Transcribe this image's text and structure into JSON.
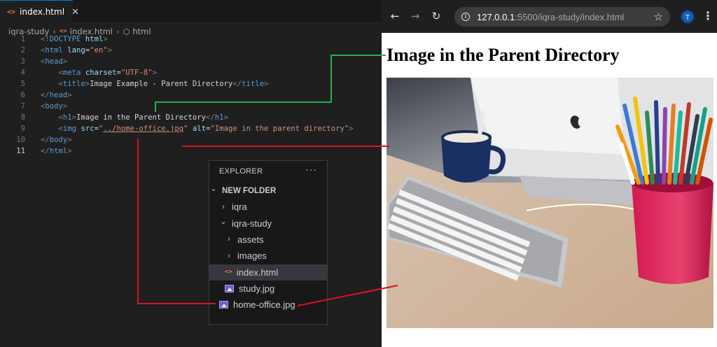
{
  "editor": {
    "tab": {
      "filename": "index.html",
      "close": "✕"
    },
    "breadcrumb": {
      "folder": "iqra-study",
      "file": "index.html",
      "symbol": "html"
    },
    "lines": [
      {
        "n": "1",
        "parts": [
          [
            "tg",
            "<!"
          ],
          [
            "tn",
            "DOCTYPE"
          ],
          [
            "pl",
            " "
          ],
          [
            "an",
            "html"
          ],
          [
            "tg",
            ">"
          ]
        ]
      },
      {
        "n": "2",
        "parts": [
          [
            "tg",
            "<"
          ],
          [
            "tn",
            "html"
          ],
          [
            "pl",
            " "
          ],
          [
            "an",
            "lang"
          ],
          [
            "pl",
            "="
          ],
          [
            "av",
            "\"en\""
          ],
          [
            "tg",
            ">"
          ]
        ]
      },
      {
        "n": "3",
        "parts": [
          [
            "tg",
            "<"
          ],
          [
            "tn",
            "head"
          ],
          [
            "tg",
            ">"
          ]
        ]
      },
      {
        "n": "4",
        "parts": [
          [
            "pl",
            "    "
          ],
          [
            "tg",
            "<"
          ],
          [
            "tn",
            "meta"
          ],
          [
            "pl",
            " "
          ],
          [
            "an",
            "charset"
          ],
          [
            "pl",
            "="
          ],
          [
            "av",
            "\"UTF-8\""
          ],
          [
            "tg",
            ">"
          ]
        ]
      },
      {
        "n": "5",
        "parts": [
          [
            "pl",
            "    "
          ],
          [
            "tg",
            "<"
          ],
          [
            "tn",
            "title"
          ],
          [
            "tg",
            ">"
          ],
          [
            "pl",
            "Image Example - Parent Directory"
          ],
          [
            "tg",
            "</"
          ],
          [
            "tn",
            "title"
          ],
          [
            "tg",
            ">"
          ]
        ]
      },
      {
        "n": "6",
        "parts": [
          [
            "tg",
            "</"
          ],
          [
            "tn",
            "head"
          ],
          [
            "tg",
            ">"
          ]
        ]
      },
      {
        "n": "7",
        "parts": [
          [
            "tg",
            "<"
          ],
          [
            "tn",
            "body"
          ],
          [
            "tg",
            ">"
          ]
        ]
      },
      {
        "n": "8",
        "parts": [
          [
            "pl",
            "    "
          ],
          [
            "tg",
            "<"
          ],
          [
            "tn",
            "h1"
          ],
          [
            "tg",
            ">"
          ],
          [
            "pl",
            "Image in the Parent Directory"
          ],
          [
            "tg",
            "</"
          ],
          [
            "tn",
            "h1"
          ],
          [
            "tg",
            ">"
          ]
        ]
      },
      {
        "n": "9",
        "parts": [
          [
            "pl",
            "    "
          ],
          [
            "tg",
            "<"
          ],
          [
            "tn",
            "img"
          ],
          [
            "pl",
            " "
          ],
          [
            "an",
            "src"
          ],
          [
            "pl",
            "="
          ],
          [
            "av",
            "\""
          ],
          [
            "avu",
            "../home-office.jpg"
          ],
          [
            "av",
            "\""
          ],
          [
            "pl",
            " "
          ],
          [
            "an",
            "alt"
          ],
          [
            "pl",
            "="
          ],
          [
            "av",
            "\"Image in the parent directory\""
          ],
          [
            "tg",
            ">"
          ]
        ]
      },
      {
        "n": "10",
        "parts": [
          [
            "tg",
            "</"
          ],
          [
            "tn",
            "body"
          ],
          [
            "tg",
            ">"
          ]
        ]
      },
      {
        "n": "11",
        "parts": [
          [
            "tg",
            "</"
          ],
          [
            "tn",
            "html"
          ],
          [
            "tg",
            ">"
          ]
        ]
      }
    ],
    "active_line": "11"
  },
  "explorer": {
    "header": "EXPLORER",
    "more": "···",
    "items": [
      {
        "label": "NEW FOLDER",
        "chevron": "down",
        "indent": 0,
        "kind": "root"
      },
      {
        "label": "iqra",
        "chevron": "right",
        "indent": 1,
        "kind": "folder"
      },
      {
        "label": "iqra-study",
        "chevron": "down",
        "indent": 1,
        "kind": "folder"
      },
      {
        "label": "assets",
        "chevron": "right",
        "indent": 2,
        "kind": "folder"
      },
      {
        "label": "images",
        "chevron": "right",
        "indent": 2,
        "kind": "folder"
      },
      {
        "label": "index.html",
        "chevron": "",
        "indent": 2,
        "kind": "html",
        "selected": true
      },
      {
        "label": "study.jpg",
        "chevron": "",
        "indent": 2,
        "kind": "image"
      },
      {
        "label": "home-office.jpg",
        "chevron": "",
        "indent": 1,
        "kind": "image"
      }
    ]
  },
  "browser": {
    "url_host": "127.0.0.1",
    "url_rest": ":5500/iqra-study/index.html",
    "profile_initial": "T",
    "page_heading": "Image in the Parent Directory"
  },
  "icons": {
    "back": "back-arrow-icon",
    "forward": "forward-arrow-icon",
    "reload": "reload-icon",
    "info": "site-info-icon",
    "bookmark": "star-icon",
    "menu": "kebab-menu-icon"
  },
  "colors": {
    "annotation_green": "#22b14c",
    "annotation_red": "#d9141b",
    "html_icon": "#e37933",
    "selection": "#37373d"
  }
}
